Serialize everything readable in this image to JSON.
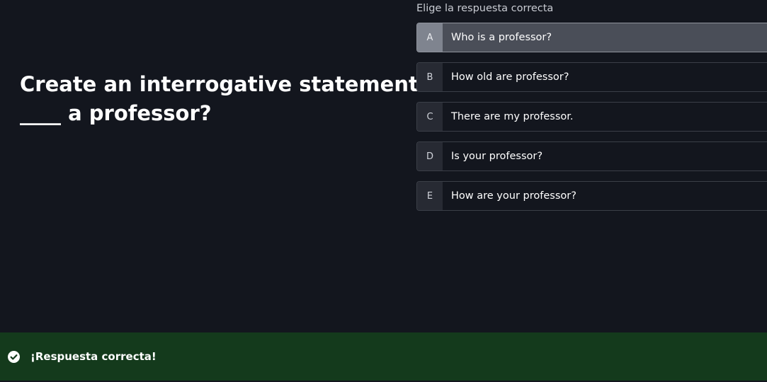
{
  "question": {
    "line1": "Create an interrogative statement:",
    "line2": "____ a professor?"
  },
  "instruction": "Elige la respuesta correcta",
  "options": [
    {
      "letter": "A",
      "text": "Who is a professor?",
      "selected": true
    },
    {
      "letter": "B",
      "text": "How old are professor?",
      "selected": false
    },
    {
      "letter": "C",
      "text": "There are my professor.",
      "selected": false
    },
    {
      "letter": "D",
      "text": "Is your professor?",
      "selected": false
    },
    {
      "letter": "E",
      "text": "How are your professor?",
      "selected": false
    }
  ],
  "feedback": {
    "icon": "check-circle-icon",
    "message": "¡Respuesta correcta!",
    "color": "#143a1c"
  }
}
